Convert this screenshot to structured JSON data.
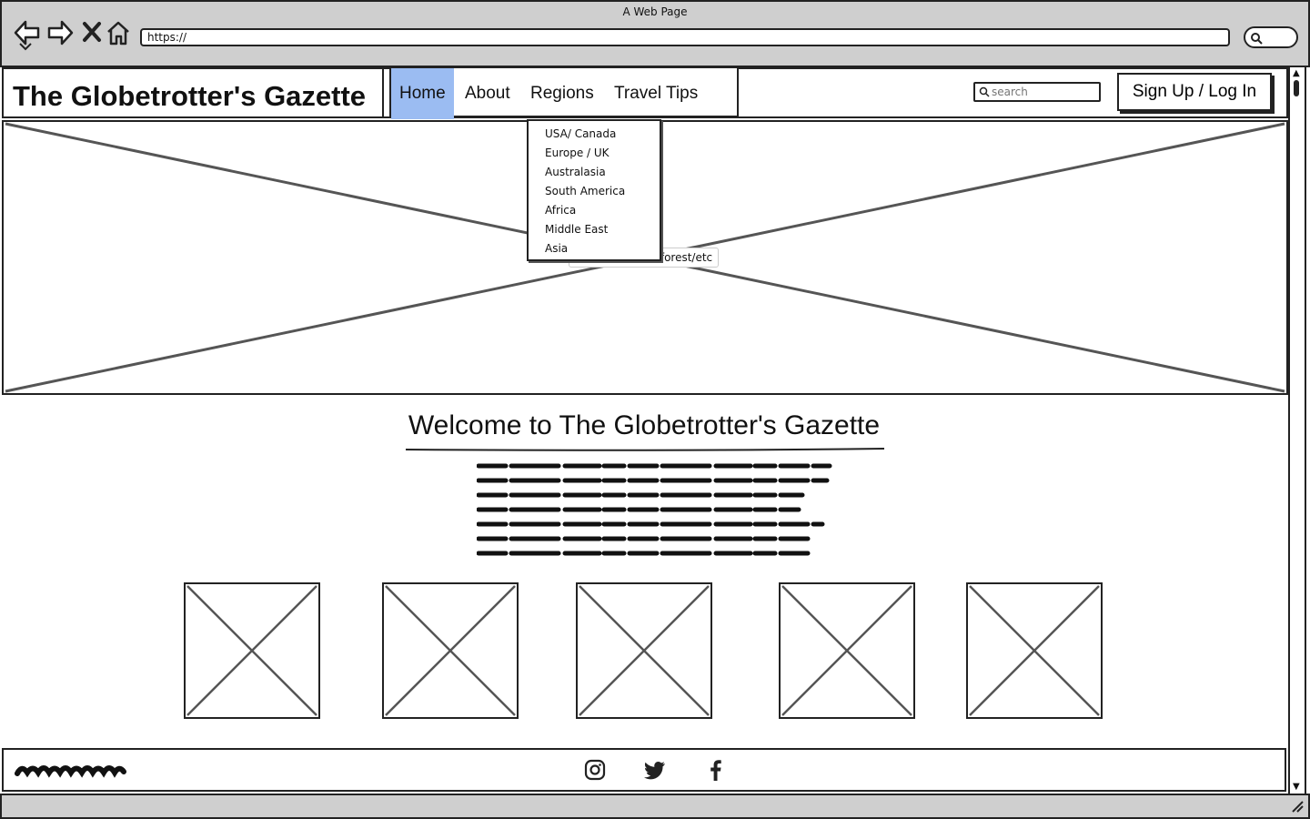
{
  "browser": {
    "window_title": "A Web Page",
    "url": "https://",
    "icons": [
      "back-icon",
      "forward-icon",
      "close-icon",
      "home-icon",
      "search-icon"
    ]
  },
  "header": {
    "site_title": "The Globetrotter's Gazette",
    "nav": [
      {
        "label": "Home",
        "active": true
      },
      {
        "label": "About",
        "active": false
      },
      {
        "label": "Regions",
        "active": false
      },
      {
        "label": "Travel Tips",
        "active": false
      }
    ],
    "search_placeholder": "search",
    "signup_label": "Sign Up / Log In"
  },
  "regions_dropdown": [
    "USA/ Canada",
    "Europe / UK",
    "Australasia",
    "South America",
    "Africa",
    "Middle East",
    "Asia"
  ],
  "hero": {
    "caption": "forest/etc"
  },
  "welcome": {
    "heading": "Welcome to The Globetrotter's Gazette"
  },
  "footer": {
    "social_icons": [
      "instagram-icon",
      "twitter-icon",
      "facebook-icon"
    ]
  },
  "colors": {
    "active_nav": "#9bbcf2",
    "chrome": "#cfcfcf",
    "ink": "#222222"
  }
}
